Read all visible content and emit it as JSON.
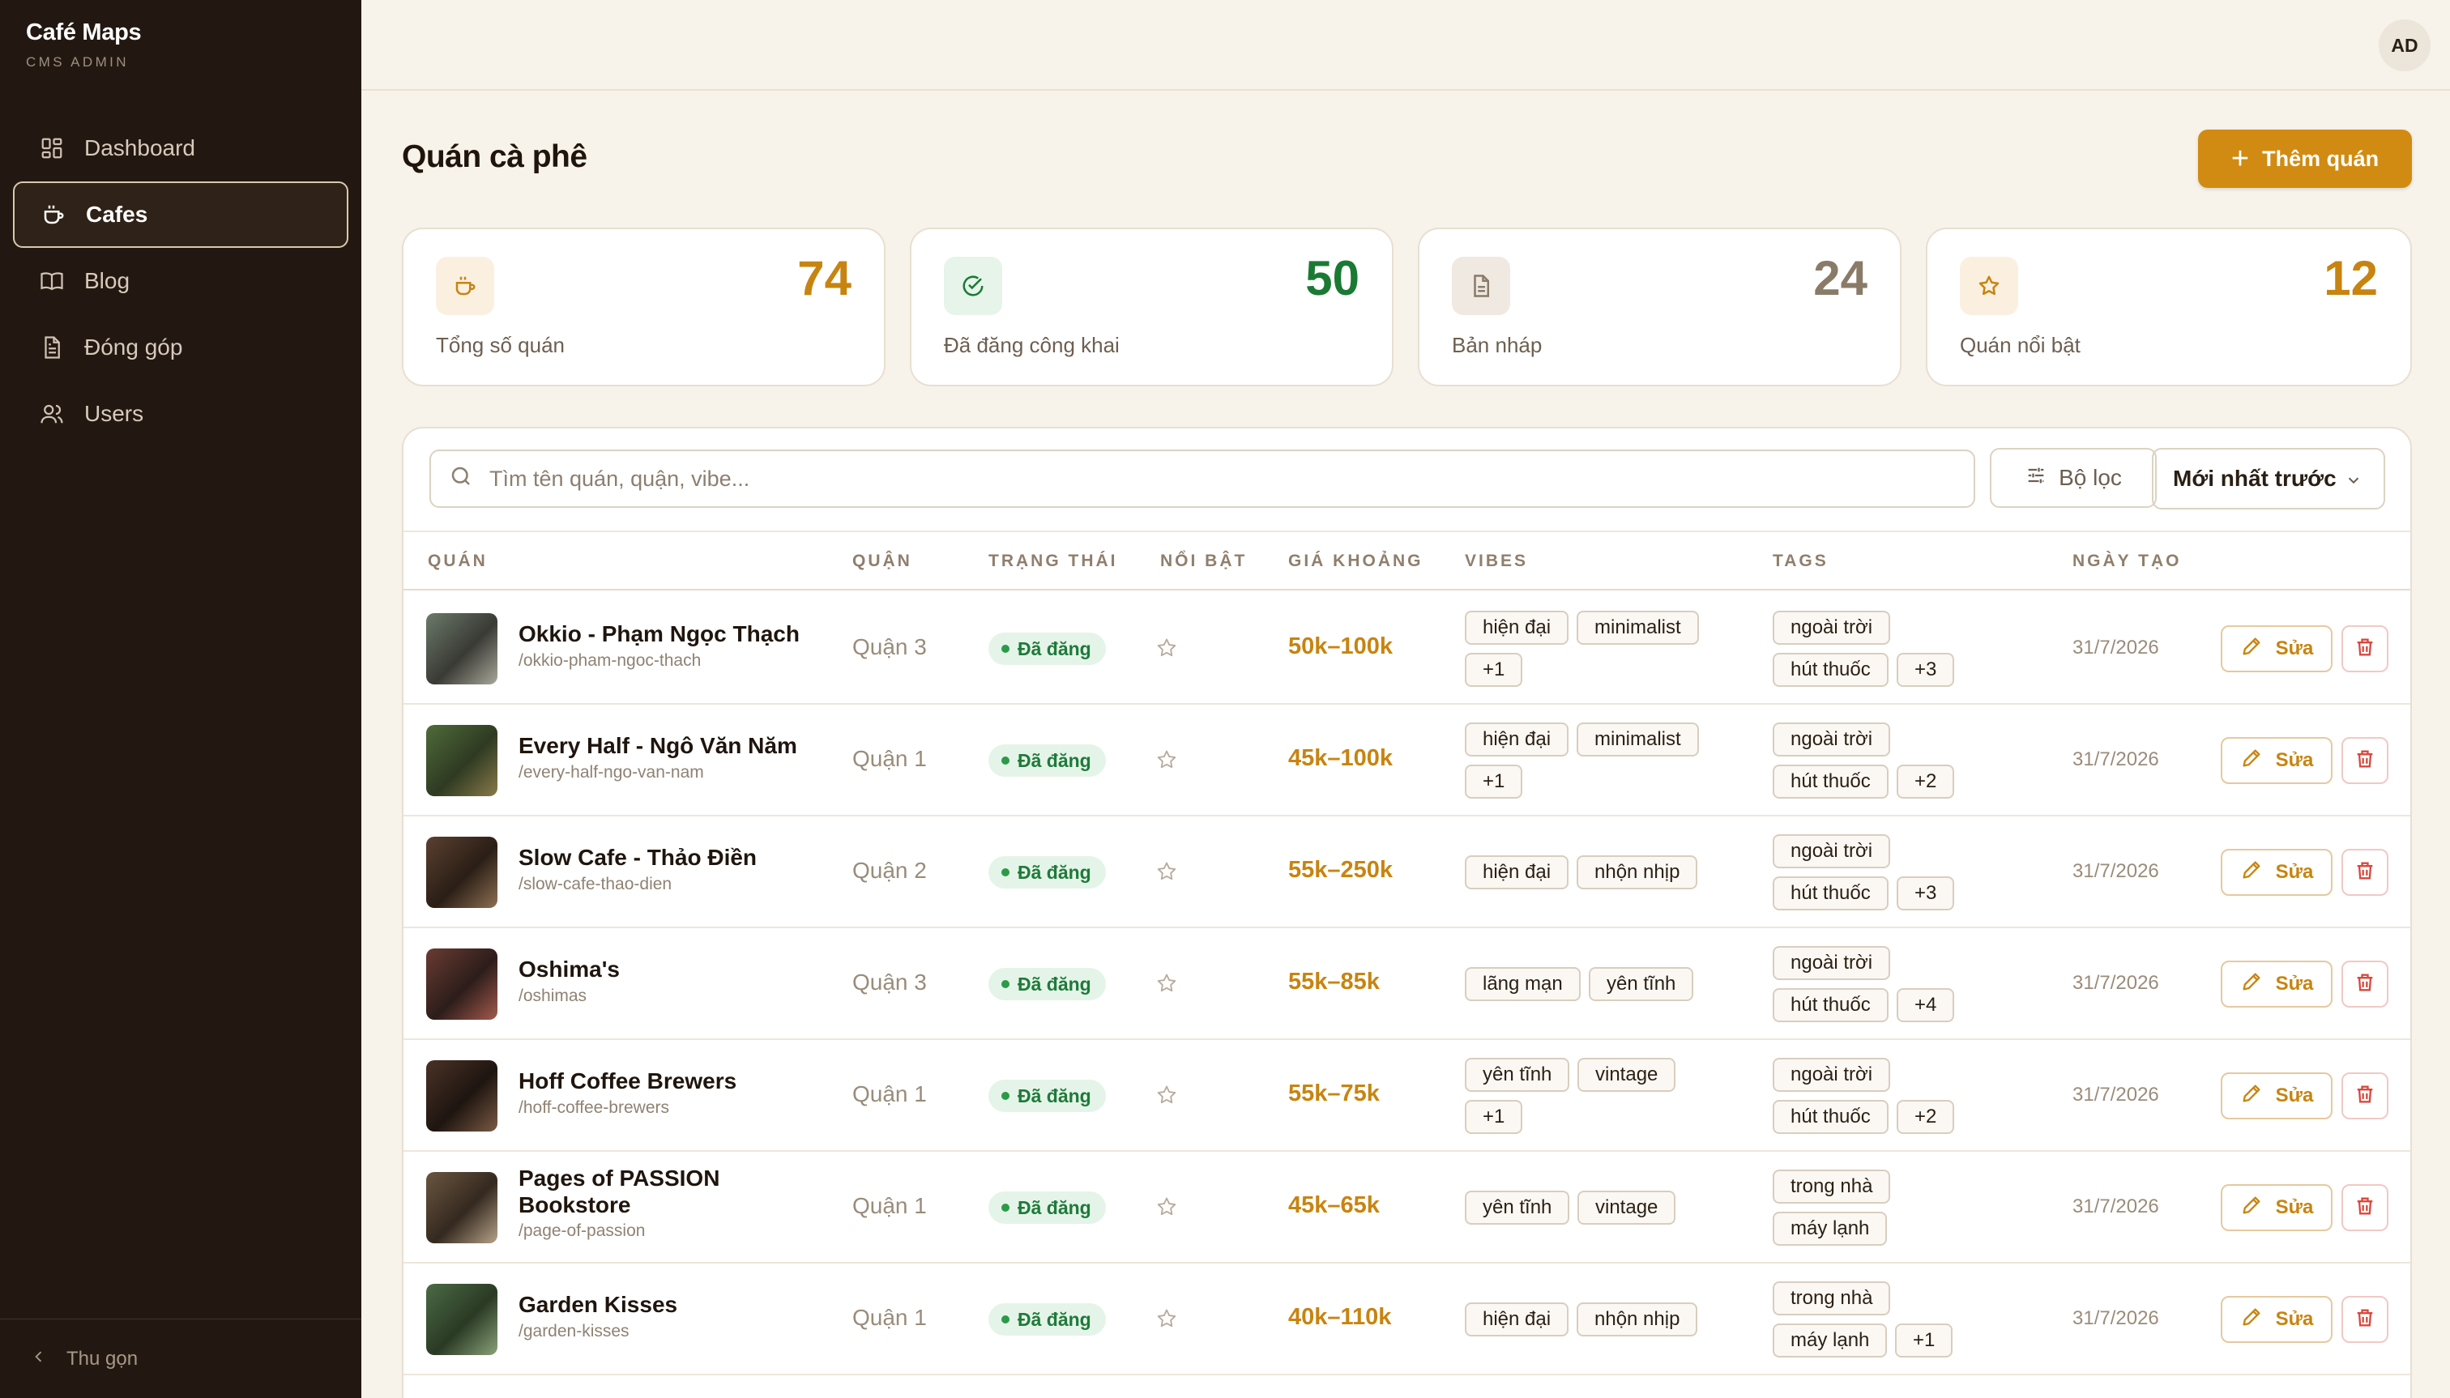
{
  "sidebar": {
    "brand_title": "Café Maps",
    "brand_sub": "CMS ADMIN",
    "items": [
      {
        "label": "Dashboard",
        "icon": "grid-icon"
      },
      {
        "label": "Cafes",
        "icon": "coffee-cup-icon",
        "active": true
      },
      {
        "label": "Blog",
        "icon": "book-icon"
      },
      {
        "label": "Đóng góp",
        "icon": "document-icon"
      },
      {
        "label": "Users",
        "icon": "users-icon"
      }
    ],
    "collapse_label": "Thu gọn"
  },
  "topbar": {
    "avatar_initials": "AD"
  },
  "page": {
    "title": "Quán cà phê",
    "add_button": "Thêm quán"
  },
  "stats": [
    {
      "value": "74",
      "label": "Tổng số quán",
      "color": "#c88410",
      "icon": "coffee-cup-icon"
    },
    {
      "value": "50",
      "label": "Đã đăng công khai",
      "color": "#1a7a34",
      "icon": "check-circle-icon"
    },
    {
      "value": "24",
      "label": "Bản nháp",
      "color": "#8a7b69",
      "icon": "document-icon"
    },
    {
      "value": "12",
      "label": "Quán nổi bật",
      "color": "#c88410",
      "icon": "star-icon"
    }
  ],
  "toolbar": {
    "search_placeholder": "Tìm tên quán, quận, vibe...",
    "filter_label": "Bộ lọc",
    "sort_label": "Mới nhất trước"
  },
  "table": {
    "headers": [
      "QUÁN",
      "QUẬN",
      "TRẠNG THÁI",
      "NỔI BẬT",
      "GIÁ KHOẢNG",
      "VIBES",
      "TAGS",
      "NGÀY TẠO"
    ],
    "edit_label": "Sửa",
    "rows": [
      {
        "name": "Okkio - Phạm Ngọc Thạch",
        "slug": "/okkio-pham-ngoc-thach",
        "district": "Quận 3",
        "status": "Đã đăng",
        "price": "50k–100k",
        "vibes": [
          "hiện đại",
          "minimalist",
          "+1"
        ],
        "tags": [
          "ngoài trời",
          "hút thuốc",
          "+3"
        ],
        "date": "31/7/2026"
      },
      {
        "name": "Every Half - Ngô Văn Năm",
        "slug": "/every-half-ngo-van-nam",
        "district": "Quận 1",
        "status": "Đã đăng",
        "price": "45k–100k",
        "vibes": [
          "hiện đại",
          "minimalist",
          "+1"
        ],
        "tags": [
          "ngoài trời",
          "hút thuốc",
          "+2"
        ],
        "date": "31/7/2026"
      },
      {
        "name": "Slow Cafe - Thảo Điền",
        "slug": "/slow-cafe-thao-dien",
        "district": "Quận 2",
        "status": "Đã đăng",
        "price": "55k–250k",
        "vibes": [
          "hiện đại",
          "nhộn nhịp"
        ],
        "tags": [
          "ngoài trời",
          "hút thuốc",
          "+3"
        ],
        "date": "31/7/2026"
      },
      {
        "name": "Oshima's",
        "slug": "/oshimas",
        "district": "Quận 3",
        "status": "Đã đăng",
        "price": "55k–85k",
        "vibes": [
          "lãng mạn",
          "yên tĩnh"
        ],
        "tags": [
          "ngoài trời",
          "hút thuốc",
          "+4"
        ],
        "date": "31/7/2026"
      },
      {
        "name": "Hoff Coffee Brewers",
        "slug": "/hoff-coffee-brewers",
        "district": "Quận 1",
        "status": "Đã đăng",
        "price": "55k–75k",
        "vibes": [
          "yên tĩnh",
          "vintage",
          "+1"
        ],
        "tags": [
          "ngoài trời",
          "hút thuốc",
          "+2"
        ],
        "date": "31/7/2026"
      },
      {
        "name": "Pages of PASSION Bookstore",
        "slug": "/page-of-passion",
        "district": "Quận 1",
        "status": "Đã đăng",
        "price": "45k–65k",
        "vibes": [
          "yên tĩnh",
          "vintage"
        ],
        "tags": [
          "trong nhà",
          "máy lạnh"
        ],
        "date": "31/7/2026"
      },
      {
        "name": "Garden Kisses",
        "slug": "/garden-kisses",
        "district": "Quận 1",
        "status": "Đã đăng",
        "price": "40k–110k",
        "vibes": [
          "hiện đại",
          "nhộn nhịp"
        ],
        "tags": [
          "trong nhà",
          "máy lạnh",
          "+1"
        ],
        "date": "31/7/2026"
      }
    ]
  },
  "colors": {
    "accent": "#d18b12",
    "sidebar_bg": "#231811",
    "page_bg": "#f7f2ea",
    "success": "#1e7a3a",
    "danger": "#d9483b"
  }
}
